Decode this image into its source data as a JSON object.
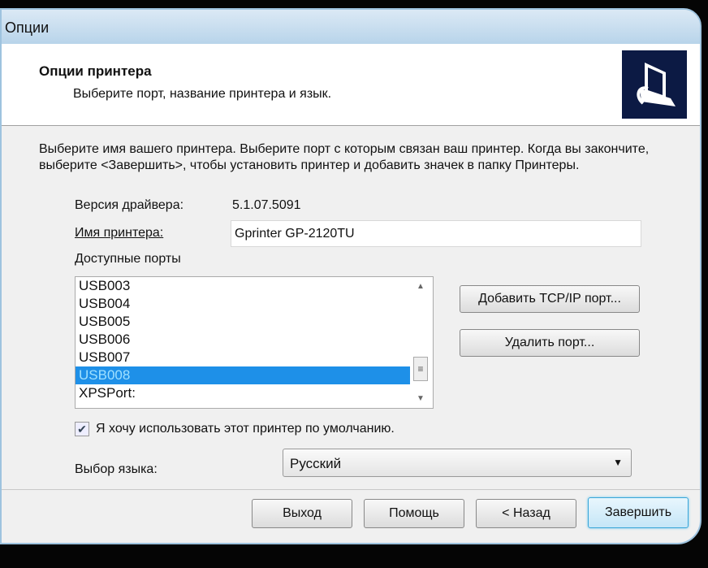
{
  "window": {
    "title": "Опции"
  },
  "header": {
    "title": "Опции принтера",
    "subtitle": "Выберите порт, название принтера и язык.",
    "icon": "printer-setup-icon"
  },
  "intro": "Выберите имя вашего принтера. Выберите порт с которым связан ваш принтер. Когда вы закончите, выберите <Завершить>, чтобы установить принтер и добавить значек в папку Принтеры.",
  "driver": {
    "label": "Версия драйвера:",
    "value": "5.1.07.5091"
  },
  "printer_name": {
    "label": "Имя принтера:",
    "value": "Gprinter  GP-2120TU"
  },
  "ports": {
    "label": "Доступные порты",
    "items": [
      "USB003",
      "USB004",
      "USB005",
      "USB006",
      "USB007",
      "USB008",
      "XPSPort:"
    ],
    "selected": "USB008"
  },
  "buttons": {
    "add_port": "Добавить TCP/IP порт...",
    "delete_port": "Удалить порт...",
    "exit": "Выход",
    "help": "Помощь",
    "back": "< Назад",
    "finish": "Завершить"
  },
  "default_checkbox": {
    "label": "Я хочу использовать этот принтер по умолчанию.",
    "checked": true
  },
  "language": {
    "label": "Выбор языка:",
    "value": "Русский"
  }
}
